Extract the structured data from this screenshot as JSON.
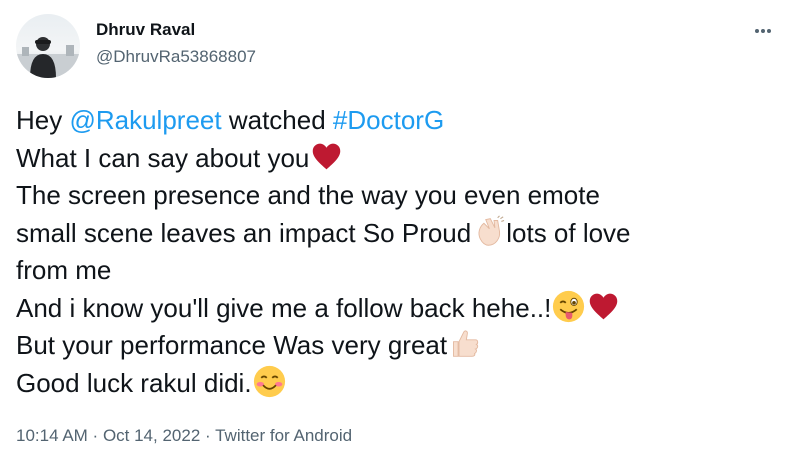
{
  "author": {
    "name": "Dhruv Raval",
    "handle": "@DhruvRa53868807"
  },
  "tweet": {
    "l1_pre": "Hey ",
    "l1_mention": "@Rakulpreet",
    "l1_mid": " watched ",
    "l1_hashtag": "#DoctorG",
    "l2": "What I can say about you",
    "l3": "The screen presence and the way you even emote",
    "l4_pre": "small scene leaves an impact So Proud",
    "l4_post": "lots of love",
    "l5": "from me",
    "l6": "And i know you'll give me a follow back hehe..!",
    "l7": "But your performance Was very great",
    "l8": "Good luck rakul didi."
  },
  "meta": {
    "time": "10:14 AM",
    "sep1": " · ",
    "date": "Oct 14, 2022",
    "sep2": " · ",
    "source": "Twitter for Android"
  },
  "icons": {
    "more": "more-horizontal-icon",
    "heart": "red-heart-emoji",
    "clap": "clapping-hands-emoji",
    "wink": "winking-tongue-emoji",
    "thumbs": "thumbs-up-emoji",
    "smile": "smiling-blush-emoji"
  },
  "colors": {
    "link": "#1d9bf0",
    "secondary": "#536471",
    "heart": "#be1931"
  }
}
